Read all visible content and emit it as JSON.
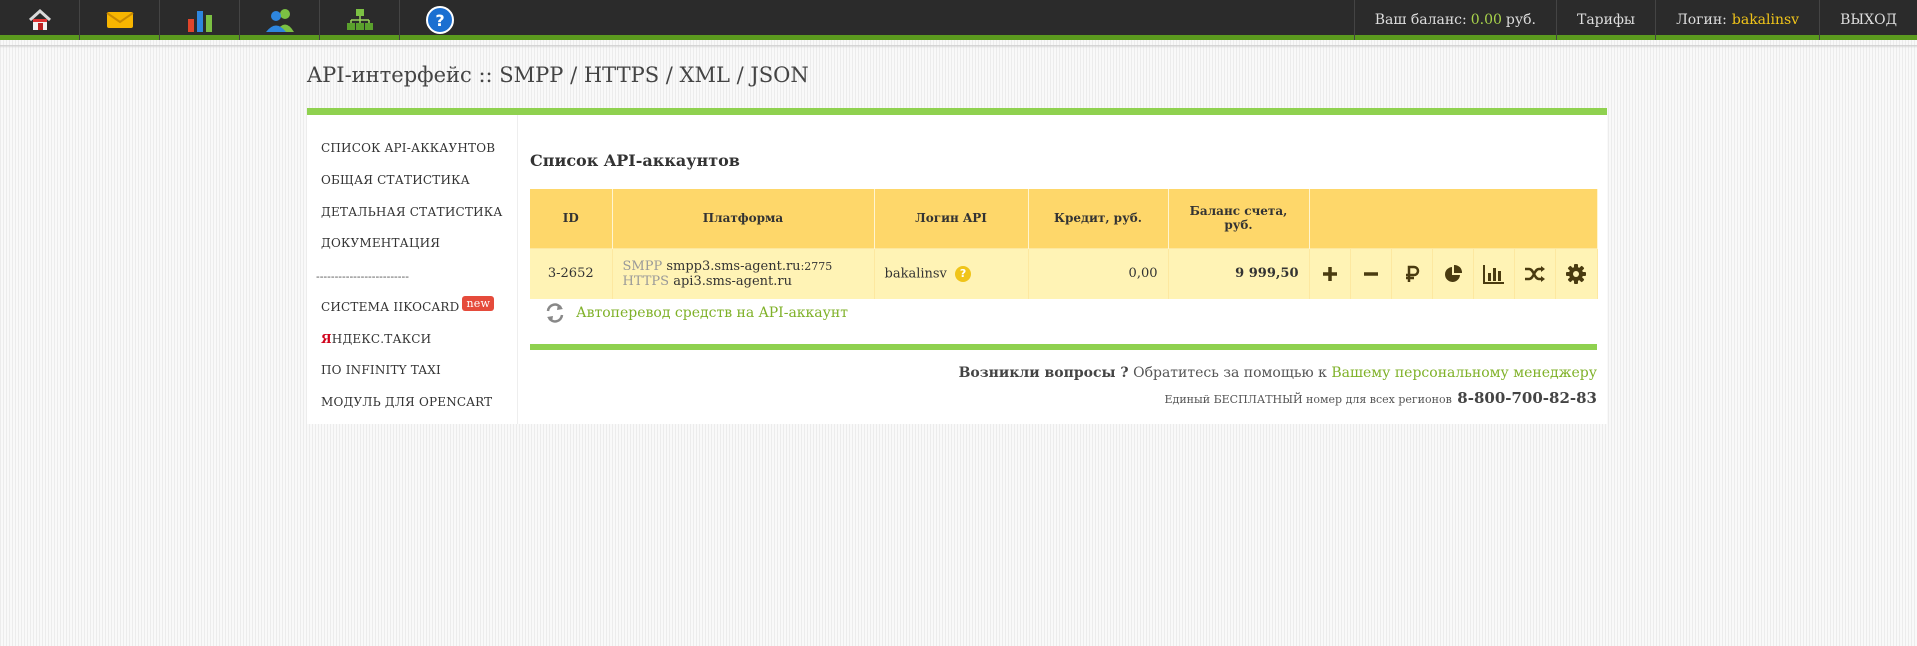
{
  "topbar": {
    "nav_icons": [
      {
        "name": "home-icon"
      },
      {
        "name": "mail-icon"
      },
      {
        "name": "bar-chart-icon"
      },
      {
        "name": "contacts-icon"
      },
      {
        "name": "structure-icon"
      },
      {
        "name": "help-icon"
      }
    ],
    "balance_label": "Ваш баланс:",
    "balance_value": "0.00",
    "balance_currency": "руб.",
    "tariffs": "Тарифы",
    "login_label": "Логин:",
    "login_value": "bakalinsv",
    "logout": "ВЫХОД",
    "colors": {
      "bar": "#2b2b2b",
      "accent": "#5b9a1e",
      "highlight": "#a9d44b",
      "login": "#f0c419"
    }
  },
  "page_title": "API-интерфейс :: SMPP / HTTPS / XML / JSON",
  "sidebar": {
    "items": [
      {
        "label": "СПИСОК API-АККАУНТОВ"
      },
      {
        "label": "ОБЩАЯ СТАТИСТИКА"
      },
      {
        "label": "ДЕТАЛЬНАЯ СТАТИСТИКА"
      },
      {
        "label": "ДОКУМЕНТАЦИЯ"
      }
    ],
    "separator": "-------------------------",
    "items2": [
      {
        "label": "СИСТЕМА IIKOCARD",
        "badge": "new"
      },
      {
        "label_first": "Я",
        "label_rest": "НДЕКС.ТАКСИ"
      },
      {
        "label": "ПО INFINITY TAXI"
      },
      {
        "label": "МОДУЛЬ ДЛЯ OPENCART"
      }
    ]
  },
  "main": {
    "section_title": "Список API-аккаунтов",
    "table": {
      "headers": [
        "ID",
        "Платформа",
        "Логин API",
        "Кредит, руб.",
        "Баланс счета, руб.",
        ""
      ],
      "rows": [
        {
          "id": "3-2652",
          "platform_smpp_label": "SMPP",
          "platform_smpp_host": "smpp3.sms-agent.ru",
          "platform_smpp_port": ":2775",
          "platform_https_label": "HTTPS",
          "platform_https_host": "api3.sms-agent.ru",
          "login": "bakalinsv",
          "help": "?",
          "credit": "0,00",
          "balance": "9 999,50"
        }
      ],
      "actions": [
        "plus-icon",
        "minus-icon",
        "ruble-icon",
        "pie-chart-icon",
        "bar-chart-icon",
        "shuffle-icon",
        "gear-icon"
      ]
    },
    "autotransfer": "Автоперевод средств на API-аккаунт",
    "help_question": "Возникли вопросы ?",
    "help_text": "Обратитесь за помощью к",
    "help_link": "Вашему персональному менеджеру",
    "hotline_text": "Единый БЕСПЛАТНЫЙ номер для всех регионов",
    "hotline_phone": "8-800-700-82-83",
    "colors": {
      "accent_green": "#8fd14f",
      "link_green": "#7fb128",
      "header_yellow": "#fed76a",
      "row_yellow": "#fff3b5"
    }
  }
}
